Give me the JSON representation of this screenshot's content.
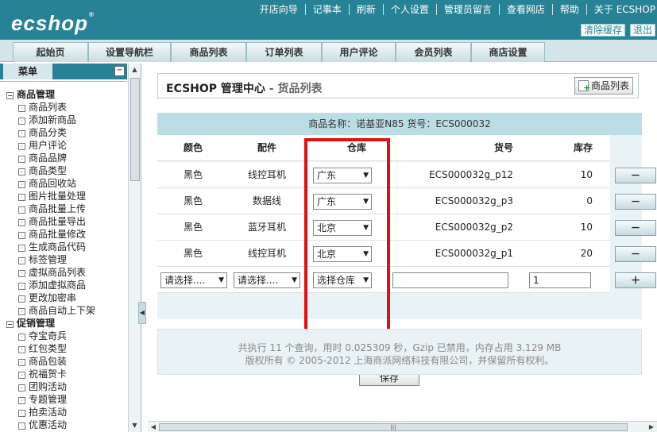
{
  "header": {
    "logo": "ecshop",
    "top_links": [
      "开店向导",
      "记事本",
      "刷新",
      "个人设置",
      "管理员留言",
      "查看网店",
      "帮助",
      "关于 ECSHOP"
    ],
    "clear_cache": "清除缓存",
    "logout": "退出"
  },
  "nav": {
    "tabs": [
      "起始页",
      "设置导航栏",
      "商品列表",
      "订单列表",
      "用户评论",
      "会员列表",
      "商店设置"
    ]
  },
  "sidebar": {
    "title": "菜单",
    "groups": [
      {
        "label": "商品管理",
        "items": [
          "商品列表",
          "添加新商品",
          "商品分类",
          "用户评论",
          "商品品牌",
          "商品类型",
          "商品回收站",
          "图片批量处理",
          "商品批量上传",
          "商品批量导出",
          "商品批量修改",
          "生成商品代码",
          "标签管理",
          "虚拟商品列表",
          "添加虚拟商品",
          "更改加密串",
          "商品自动上下架"
        ]
      },
      {
        "label": "促销管理",
        "items": [
          "夺宝奇兵",
          "红包类型",
          "商品包装",
          "祝福贺卡",
          "团购活动",
          "专题管理",
          "拍卖活动",
          "优惠活动"
        ]
      }
    ]
  },
  "main": {
    "title": "ECSHOP 管理中心",
    "subtitle": " - 货品列表",
    "list_button": "商品列表",
    "product_info": "商品名称：诺基亚N85   货号：ECS000032",
    "headers": {
      "color": "颜色",
      "part": "配件",
      "warehouse": "仓库",
      "sn": "货号",
      "stock": "库存"
    },
    "rows": [
      {
        "color": "黑色",
        "part": "线控耳机",
        "warehouse": "广东",
        "sn": "ECS000032g_p12",
        "stock": "10",
        "action": "－"
      },
      {
        "color": "黑色",
        "part": "数据线",
        "warehouse": "广东",
        "sn": "ECS000032g_p3",
        "stock": "0",
        "action": "－"
      },
      {
        "color": "黑色",
        "part": "蓝牙耳机",
        "warehouse": "北京",
        "sn": "ECS000032g_p2",
        "stock": "10",
        "action": "－"
      },
      {
        "color": "黑色",
        "part": "线控耳机",
        "warehouse": "北京",
        "sn": "ECS000032g_p1",
        "stock": "20",
        "action": "－"
      }
    ],
    "new_row": {
      "color_select": "请选择....",
      "part_select": "请选择....",
      "warehouse_select": "选择仓库",
      "sn": "",
      "stock": "1",
      "action": "＋"
    },
    "save": "保存",
    "footer_line1": "共执行 11 个查询，用时 0.025309 秒，Gzip 已禁用，内存占用 3.129 MB",
    "footer_line2": "版权所有 © 2005-2012 上海商派网络科技有限公司，并保留所有权利。"
  }
}
